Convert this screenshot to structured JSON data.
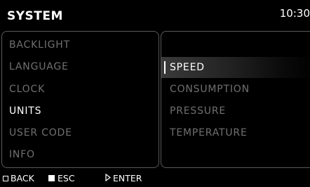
{
  "header": {
    "title": "SYSTEM",
    "time": "10:30"
  },
  "left_menu": {
    "items": [
      {
        "label": "BACKLIGHT",
        "active": false
      },
      {
        "label": "LANGUAGE",
        "active": false
      },
      {
        "label": "CLOCK",
        "active": false
      },
      {
        "label": "UNITS",
        "active": true
      },
      {
        "label": "USER CODE",
        "active": false
      },
      {
        "label": "INFO",
        "active": false
      }
    ]
  },
  "right_menu": {
    "items": [
      {
        "label": "SPEED",
        "selected": true
      },
      {
        "label": "CONSUMPTION",
        "selected": false
      },
      {
        "label": "PRESSURE",
        "selected": false
      },
      {
        "label": "TEMPERATURE",
        "selected": false
      }
    ]
  },
  "footer": {
    "back": {
      "label": "BACK",
      "icon": "square-outline-icon"
    },
    "esc": {
      "label": "ESC",
      "icon": "square-filled-icon"
    },
    "enter": {
      "label": "ENTER",
      "icon": "triangle-right-icon"
    }
  },
  "colors": {
    "background": "#000000",
    "text": "#ffffff",
    "inactive_text": "#707070",
    "border": "#5a5a5a"
  }
}
